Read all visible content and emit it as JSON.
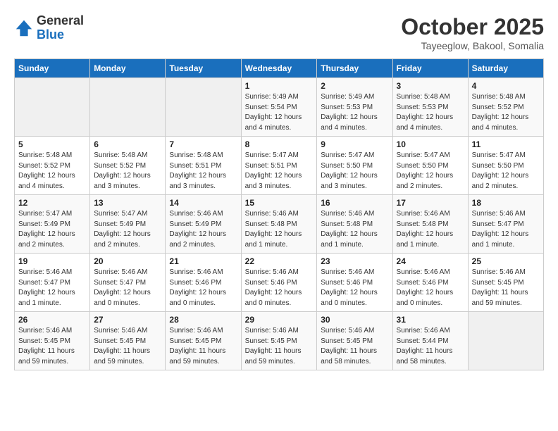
{
  "header": {
    "logo_general": "General",
    "logo_blue": "Blue",
    "month": "October 2025",
    "location": "Tayeeglow, Bakool, Somalia"
  },
  "days_of_week": [
    "Sunday",
    "Monday",
    "Tuesday",
    "Wednesday",
    "Thursday",
    "Friday",
    "Saturday"
  ],
  "weeks": [
    [
      {
        "day": "",
        "info": ""
      },
      {
        "day": "",
        "info": ""
      },
      {
        "day": "",
        "info": ""
      },
      {
        "day": "1",
        "info": "Sunrise: 5:49 AM\nSunset: 5:54 PM\nDaylight: 12 hours\nand 4 minutes."
      },
      {
        "day": "2",
        "info": "Sunrise: 5:49 AM\nSunset: 5:53 PM\nDaylight: 12 hours\nand 4 minutes."
      },
      {
        "day": "3",
        "info": "Sunrise: 5:48 AM\nSunset: 5:53 PM\nDaylight: 12 hours\nand 4 minutes."
      },
      {
        "day": "4",
        "info": "Sunrise: 5:48 AM\nSunset: 5:52 PM\nDaylight: 12 hours\nand 4 minutes."
      }
    ],
    [
      {
        "day": "5",
        "info": "Sunrise: 5:48 AM\nSunset: 5:52 PM\nDaylight: 12 hours\nand 4 minutes."
      },
      {
        "day": "6",
        "info": "Sunrise: 5:48 AM\nSunset: 5:52 PM\nDaylight: 12 hours\nand 3 minutes."
      },
      {
        "day": "7",
        "info": "Sunrise: 5:48 AM\nSunset: 5:51 PM\nDaylight: 12 hours\nand 3 minutes."
      },
      {
        "day": "8",
        "info": "Sunrise: 5:47 AM\nSunset: 5:51 PM\nDaylight: 12 hours\nand 3 minutes."
      },
      {
        "day": "9",
        "info": "Sunrise: 5:47 AM\nSunset: 5:50 PM\nDaylight: 12 hours\nand 3 minutes."
      },
      {
        "day": "10",
        "info": "Sunrise: 5:47 AM\nSunset: 5:50 PM\nDaylight: 12 hours\nand 2 minutes."
      },
      {
        "day": "11",
        "info": "Sunrise: 5:47 AM\nSunset: 5:50 PM\nDaylight: 12 hours\nand 2 minutes."
      }
    ],
    [
      {
        "day": "12",
        "info": "Sunrise: 5:47 AM\nSunset: 5:49 PM\nDaylight: 12 hours\nand 2 minutes."
      },
      {
        "day": "13",
        "info": "Sunrise: 5:47 AM\nSunset: 5:49 PM\nDaylight: 12 hours\nand 2 minutes."
      },
      {
        "day": "14",
        "info": "Sunrise: 5:46 AM\nSunset: 5:49 PM\nDaylight: 12 hours\nand 2 minutes."
      },
      {
        "day": "15",
        "info": "Sunrise: 5:46 AM\nSunset: 5:48 PM\nDaylight: 12 hours\nand 1 minute."
      },
      {
        "day": "16",
        "info": "Sunrise: 5:46 AM\nSunset: 5:48 PM\nDaylight: 12 hours\nand 1 minute."
      },
      {
        "day": "17",
        "info": "Sunrise: 5:46 AM\nSunset: 5:48 PM\nDaylight: 12 hours\nand 1 minute."
      },
      {
        "day": "18",
        "info": "Sunrise: 5:46 AM\nSunset: 5:47 PM\nDaylight: 12 hours\nand 1 minute."
      }
    ],
    [
      {
        "day": "19",
        "info": "Sunrise: 5:46 AM\nSunset: 5:47 PM\nDaylight: 12 hours\nand 1 minute."
      },
      {
        "day": "20",
        "info": "Sunrise: 5:46 AM\nSunset: 5:47 PM\nDaylight: 12 hours\nand 0 minutes."
      },
      {
        "day": "21",
        "info": "Sunrise: 5:46 AM\nSunset: 5:46 PM\nDaylight: 12 hours\nand 0 minutes."
      },
      {
        "day": "22",
        "info": "Sunrise: 5:46 AM\nSunset: 5:46 PM\nDaylight: 12 hours\nand 0 minutes."
      },
      {
        "day": "23",
        "info": "Sunrise: 5:46 AM\nSunset: 5:46 PM\nDaylight: 12 hours\nand 0 minutes."
      },
      {
        "day": "24",
        "info": "Sunrise: 5:46 AM\nSunset: 5:46 PM\nDaylight: 12 hours\nand 0 minutes."
      },
      {
        "day": "25",
        "info": "Sunrise: 5:46 AM\nSunset: 5:45 PM\nDaylight: 11 hours\nand 59 minutes."
      }
    ],
    [
      {
        "day": "26",
        "info": "Sunrise: 5:46 AM\nSunset: 5:45 PM\nDaylight: 11 hours\nand 59 minutes."
      },
      {
        "day": "27",
        "info": "Sunrise: 5:46 AM\nSunset: 5:45 PM\nDaylight: 11 hours\nand 59 minutes."
      },
      {
        "day": "28",
        "info": "Sunrise: 5:46 AM\nSunset: 5:45 PM\nDaylight: 11 hours\nand 59 minutes."
      },
      {
        "day": "29",
        "info": "Sunrise: 5:46 AM\nSunset: 5:45 PM\nDaylight: 11 hours\nand 59 minutes."
      },
      {
        "day": "30",
        "info": "Sunrise: 5:46 AM\nSunset: 5:45 PM\nDaylight: 11 hours\nand 58 minutes."
      },
      {
        "day": "31",
        "info": "Sunrise: 5:46 AM\nSunset: 5:44 PM\nDaylight: 11 hours\nand 58 minutes."
      },
      {
        "day": "",
        "info": ""
      }
    ]
  ]
}
